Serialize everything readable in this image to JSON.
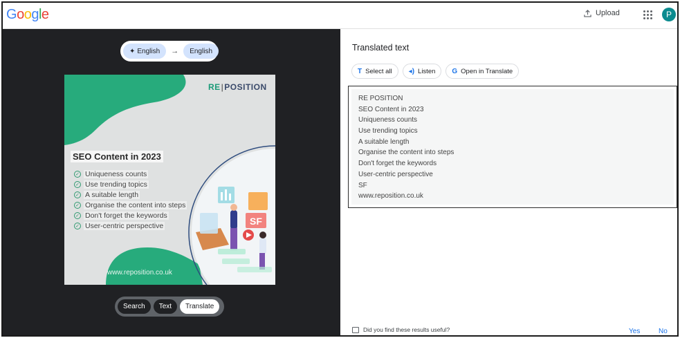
{
  "header": {
    "logo_letters": [
      {
        "ch": "G",
        "color": "#4285F4"
      },
      {
        "ch": "o",
        "color": "#EA4335"
      },
      {
        "ch": "o",
        "color": "#FBBC05"
      },
      {
        "ch": "g",
        "color": "#4285F4"
      },
      {
        "ch": "l",
        "color": "#34A853"
      },
      {
        "ch": "e",
        "color": "#EA4335"
      }
    ],
    "upload_label": "Upload",
    "avatar_letter": "P"
  },
  "source": {
    "source_lang": "English",
    "target_lang": "English",
    "arrow": "→",
    "image": {
      "brand_left": "RE",
      "brand_right": "POSITION",
      "heading": "SEO Content in 2023",
      "items": [
        "Uniqueness counts",
        "Use trending topics",
        "A suitable length",
        "Organise the content into steps",
        "Don't forget the keywords",
        "User-centric perspective"
      ],
      "badge": "SF",
      "url": "www.reposition.co.uk"
    },
    "modes": [
      "Search",
      "Text",
      "Translate"
    ],
    "active_mode": "Translate"
  },
  "result": {
    "title": "Translated text",
    "actions": [
      {
        "icon": "T",
        "label": "Select all"
      },
      {
        "icon": "◂)",
        "label": "Listen"
      },
      {
        "icon": "G",
        "label": "Open in Translate"
      }
    ],
    "lines": [
      "RE POSITION",
      "SEO Content in 2023",
      "Uniqueness counts",
      "Use trending topics",
      "A suitable length",
      "Organise the content into steps",
      "Don't forget the keywords",
      "User-centric perspective",
      "SF",
      "www.reposition.co.uk"
    ]
  },
  "feedback": {
    "question": "Did you find these results useful?",
    "yes": "Yes",
    "no": "No"
  },
  "colors": {
    "accent_blue": "#1a73e8",
    "chip_blue": "#d3e3fd",
    "dark_panel": "#202124",
    "brand_green": "#1a9b78",
    "avatar": "#0b8b8f"
  }
}
